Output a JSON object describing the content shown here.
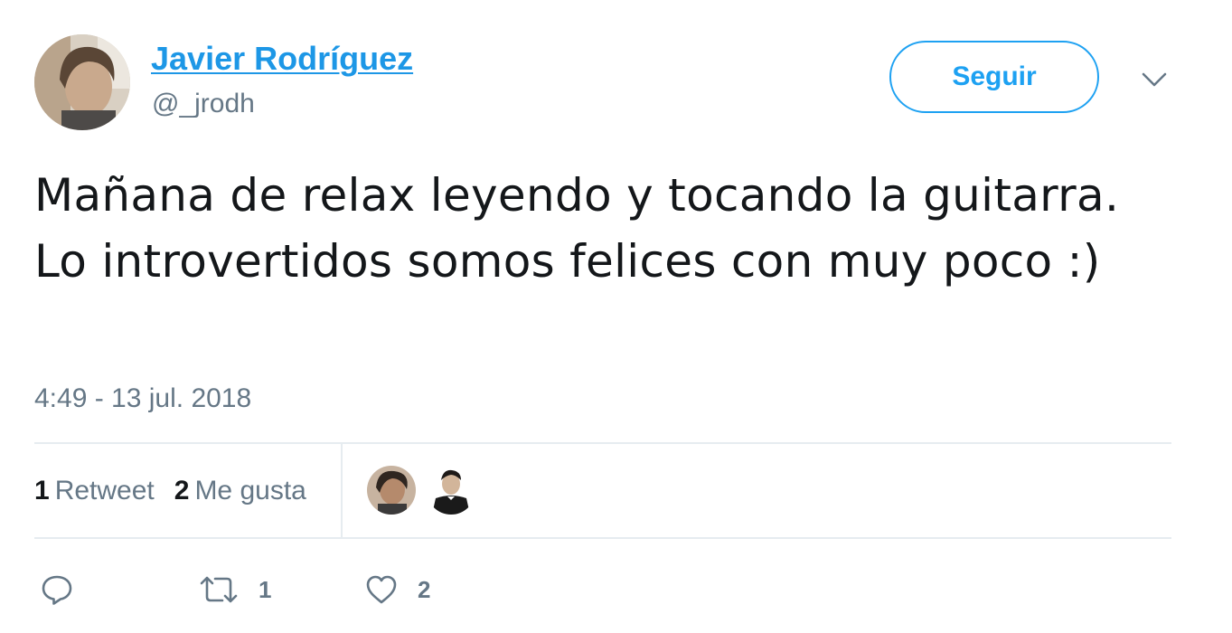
{
  "user": {
    "name": "Javier Rodríguez",
    "handle": "@_jrodh"
  },
  "follow_button": {
    "label": "Seguir"
  },
  "tweet": {
    "text": "Mañana de relax leyendo y tocando la guitarra. Lo introvertidos somos felices con muy poco :)",
    "timestamp": "4:49 - 13 jul. 2018"
  },
  "stats": {
    "retweets": {
      "count": "1",
      "label": "Retweet"
    },
    "likes": {
      "count": "2",
      "label": "Me gusta"
    }
  },
  "actions": {
    "reply_icon": "reply-icon",
    "retweet_icon": "retweet-icon",
    "retweet_count": "1",
    "like_icon": "heart-icon",
    "like_count": "2"
  },
  "colors": {
    "accent": "#1da1f2",
    "name_link": "#1d97e6",
    "muted": "#657786",
    "text": "#14171a",
    "divider": "#e6ecf0"
  }
}
